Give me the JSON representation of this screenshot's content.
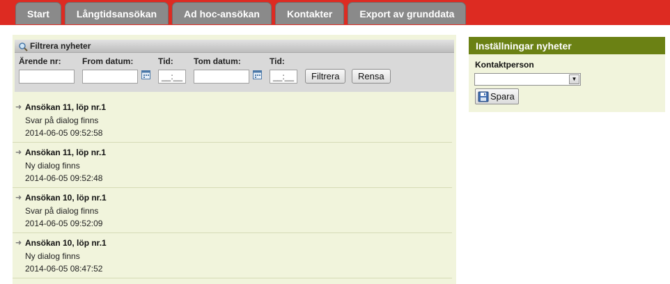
{
  "tabs": [
    {
      "label": "Start"
    },
    {
      "label": "Långtidsansökan"
    },
    {
      "label": "Ad hoc-ansökan"
    },
    {
      "label": "Kontakter"
    },
    {
      "label": "Export av grunddata"
    }
  ],
  "filter": {
    "title": "Filtrera nyheter",
    "arende_label": "Ärende nr:",
    "from_label": "From datum:",
    "tid_from_label": "Tid:",
    "tom_label": "Tom datum:",
    "tid_tom_label": "Tid:",
    "time_placeholder": "__:__",
    "filter_button": "Filtrera",
    "reset_button": "Rensa"
  },
  "news": [
    {
      "title": "Ansökan 11, löp nr.1",
      "status": "Svar på dialog finns",
      "date": "2014-06-05 09:52:58"
    },
    {
      "title": "Ansökan 11, löp nr.1",
      "status": "Ny dialog finns",
      "date": "2014-06-05 09:52:48"
    },
    {
      "title": "Ansökan 10, löp nr.1",
      "status": "Svar på dialog finns",
      "date": "2014-06-05 09:52:09"
    },
    {
      "title": "Ansökan 10, löp nr.1",
      "status": "Ny dialog finns",
      "date": "2014-06-05 08:47:52"
    }
  ],
  "settings": {
    "title": "Inställningar nyheter",
    "contact_label": "Kontaktperson",
    "contact_value": "",
    "save_button": "Spara"
  },
  "colors": {
    "topbar": "#dd2b22",
    "tab": "#8a8a8a",
    "panel": "#f1f4dc",
    "settings_header": "#6b8114"
  }
}
